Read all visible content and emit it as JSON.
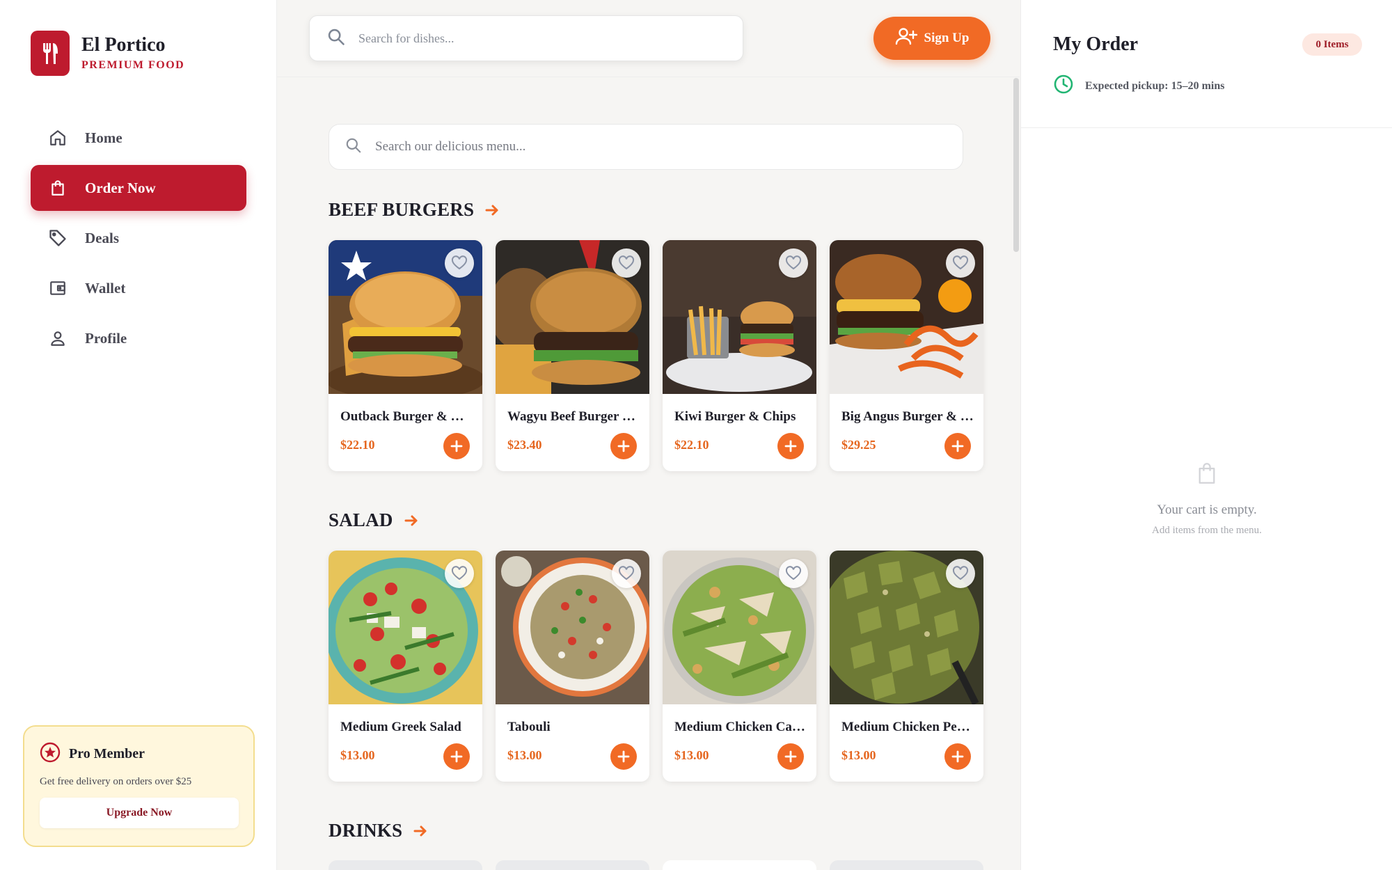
{
  "brand": {
    "name": "El Portico",
    "subtitle": "PREMIUM FOOD"
  },
  "nav": {
    "items": [
      {
        "label": "Home",
        "icon": "home-icon",
        "active": false
      },
      {
        "label": "Order Now",
        "icon": "shopping-bag-icon",
        "active": true
      },
      {
        "label": "Deals",
        "icon": "tag-icon",
        "active": false
      },
      {
        "label": "Wallet",
        "icon": "wallet-icon",
        "active": false
      },
      {
        "label": "Profile",
        "icon": "user-icon",
        "active": false
      }
    ]
  },
  "pro": {
    "title": "Pro Member",
    "description": "Get free delivery on orders over $25",
    "button": "Upgrade Now"
  },
  "header": {
    "search_placeholder": "Search for dishes...",
    "signup_label": "Sign Up"
  },
  "menu": {
    "search_placeholder": "Search our delicious menu...",
    "sections": [
      {
        "title": "BEEF BURGERS",
        "items": [
          {
            "name": "Outback Burger & Chips",
            "price": "$22.10"
          },
          {
            "name": "Wagyu Beef Burger & Chips",
            "price": "$23.40"
          },
          {
            "name": "Kiwi Burger & Chips",
            "price": "$22.10"
          },
          {
            "name": "Big Angus Burger & Chips",
            "price": "$29.25"
          }
        ]
      },
      {
        "title": "SALAD",
        "items": [
          {
            "name": "Medium Greek Salad",
            "price": "$13.00"
          },
          {
            "name": "Tabouli",
            "price": "$13.00"
          },
          {
            "name": "Medium Chicken Caesar Salad",
            "price": "$13.00"
          },
          {
            "name": "Medium Chicken Pesto Pasta",
            "price": "$13.00"
          }
        ]
      },
      {
        "title": "DRINKS",
        "items": []
      }
    ]
  },
  "order": {
    "title": "My Order",
    "badge": "0 Items",
    "pickup": "Expected pickup: 15–20 mins",
    "empty_title": "Your cart is empty.",
    "empty_subtitle": "Add items from the menu."
  },
  "colors": {
    "brand_red": "#be1b2e",
    "accent_orange": "#f16a25",
    "pro_bg": "#fff7dd",
    "pickup_green": "#22b573"
  }
}
